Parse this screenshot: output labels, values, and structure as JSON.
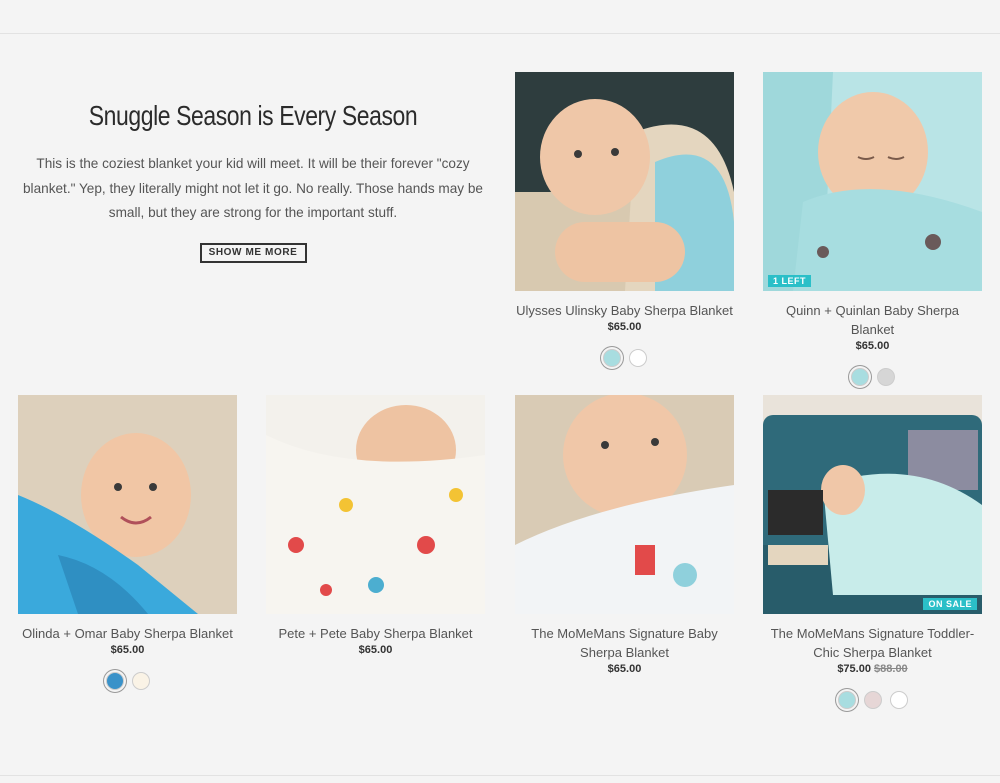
{
  "hero": {
    "title": "Snuggle Season is Every Season",
    "body": "This is the coziest blanket your kid will meet. It will be their forever \"cozy blanket.\" Yep, they literally might not let it go. No really. Those hands may be small, but they are strong for the important stuff.",
    "cta": "SHOW ME MORE"
  },
  "products": [
    {
      "name": "Ulysses Ulinsky Baby Sherpa Blanket",
      "price": "$65.00",
      "badge": "",
      "swatches": [
        "#a8dde0",
        "#ffffff"
      ]
    },
    {
      "name": "Quinn + Quinlan Baby Sherpa Blanket",
      "price": "$65.00",
      "badge": "1 LEFT",
      "swatches": [
        "#a8dde0",
        "#d6d6d6"
      ]
    },
    {
      "name": "Olinda + Omar Baby Sherpa Blanket",
      "price": "$65.00",
      "badge": "",
      "swatches": [
        "#3a92c9",
        "#faf3e6"
      ]
    },
    {
      "name": "Pete + Pete Baby Sherpa Blanket",
      "price": "$65.00",
      "badge": "",
      "swatches": []
    },
    {
      "name": "The MoMeMans Signature Baby Sherpa Blanket",
      "price": "$65.00",
      "badge": "",
      "swatches": []
    },
    {
      "name": "The MoMeMans Signature Toddler-Chic Sherpa Blanket",
      "price": "$75.00",
      "old_price": "$88.00",
      "badge": "ON SALE",
      "swatches": [
        "#a8dde0",
        "#e6d6d6",
        "#ffffff"
      ]
    }
  ]
}
